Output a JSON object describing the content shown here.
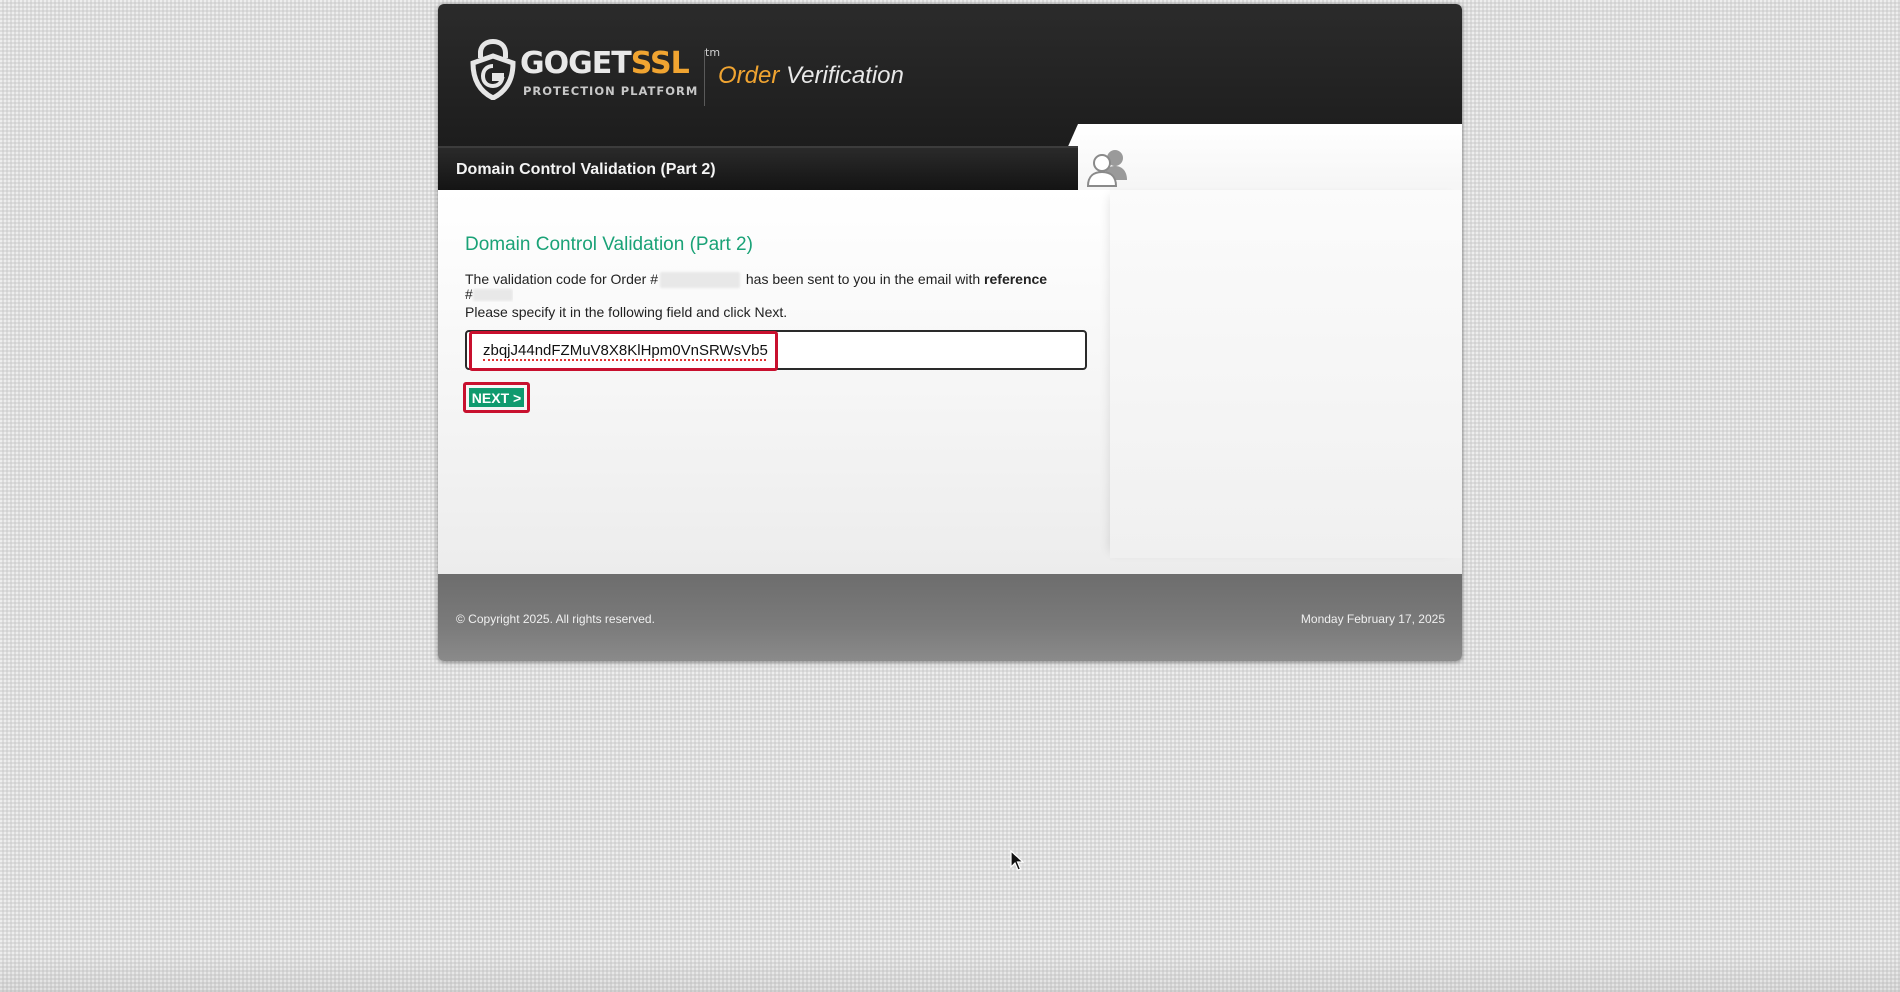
{
  "brand": {
    "logo_word_1": "GOGET",
    "logo_word_2": "SSL",
    "logo_tm": "tm",
    "logo_sub": "PROTECTION PLATFORM",
    "title_part1": "Order",
    "title_part2": "Verification"
  },
  "subheader": {
    "title": "Domain Control Validation (Part 2)"
  },
  "main": {
    "heading": "Domain Control Validation (Part 2)",
    "line1_before": "The validation code for Order #",
    "line1_after": " has been sent to you in the email with ",
    "line1_bold": "reference",
    "line2_prefix": "#",
    "line3": "Please specify it in the following field and click Next.",
    "code_value": "zbqjJ44ndFZMuV8X8KlHpm0VnSRWsVb5",
    "next_label": "NEXT >"
  },
  "footer": {
    "copyright": "© Copyright 2025. All rights reserved.",
    "date": "Monday February 17, 2025"
  },
  "colors": {
    "accent_green": "#1aa277",
    "button_green": "#0f9a6e",
    "brand_orange": "#f0a431",
    "highlight_red": "#c8102e"
  },
  "icons": [
    "shield-logo-icon",
    "users-icon",
    "mouse-cursor-icon"
  ]
}
